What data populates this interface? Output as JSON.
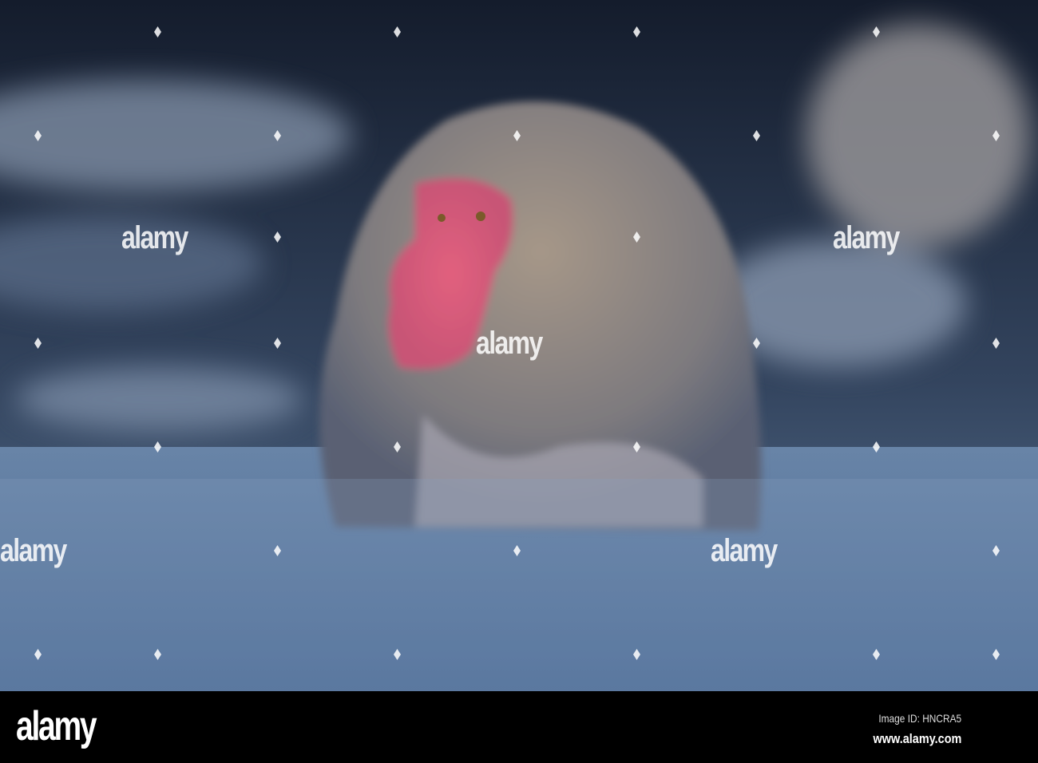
{
  "photo": {
    "subject": "snow-monkey-in-hot-spring",
    "watermark": "alamy"
  },
  "footer": {
    "logo": "alamy",
    "image_id": "Image ID: HNCRA5",
    "website": "www.alamy.com"
  }
}
